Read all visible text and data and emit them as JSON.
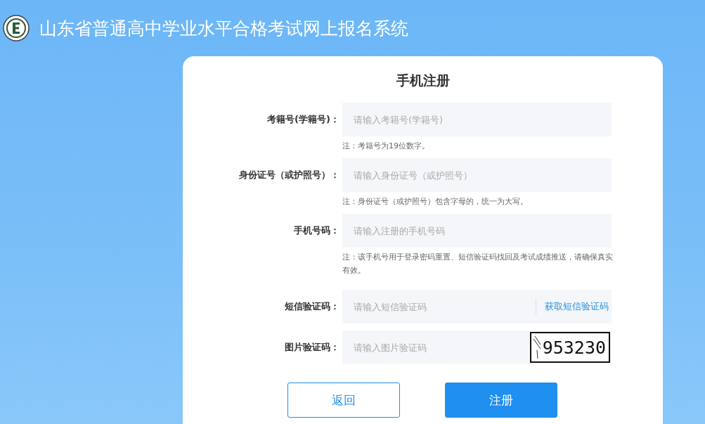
{
  "header": {
    "title": "山东省普通高中学业水平合格考试网上报名系统"
  },
  "form": {
    "title": "手机注册",
    "fields": [
      {
        "kind": "text",
        "label": "考籍号(学籍号)：",
        "placeholder": "请输入考籍号(学籍号)",
        "note": "注：考籍号为19位数字。"
      },
      {
        "kind": "text",
        "label": "身份证号（或护照号）：",
        "placeholder": "请输入身份证号（或护照号）",
        "note": "注：身份证号（或护照号）包含字母的，统一为大写。"
      },
      {
        "kind": "text",
        "label": "手机号码：",
        "placeholder": "请输入注册的手机号码",
        "note": "注：该手机号用于登录密码重置、短信验证码找回及考试成绩推送，请确保真实有效。"
      },
      {
        "kind": "sms",
        "label": "短信验证码：",
        "placeholder": "请输入短信验证码",
        "action": "获取短信验证码"
      },
      {
        "kind": "captcha",
        "label": "图片验证码：",
        "placeholder": "请输入图片验证码",
        "captcha": "953230"
      }
    ],
    "buttons": [
      {
        "kind": "outline",
        "label": "返回"
      },
      {
        "kind": "primary",
        "label": "注册"
      }
    ]
  }
}
